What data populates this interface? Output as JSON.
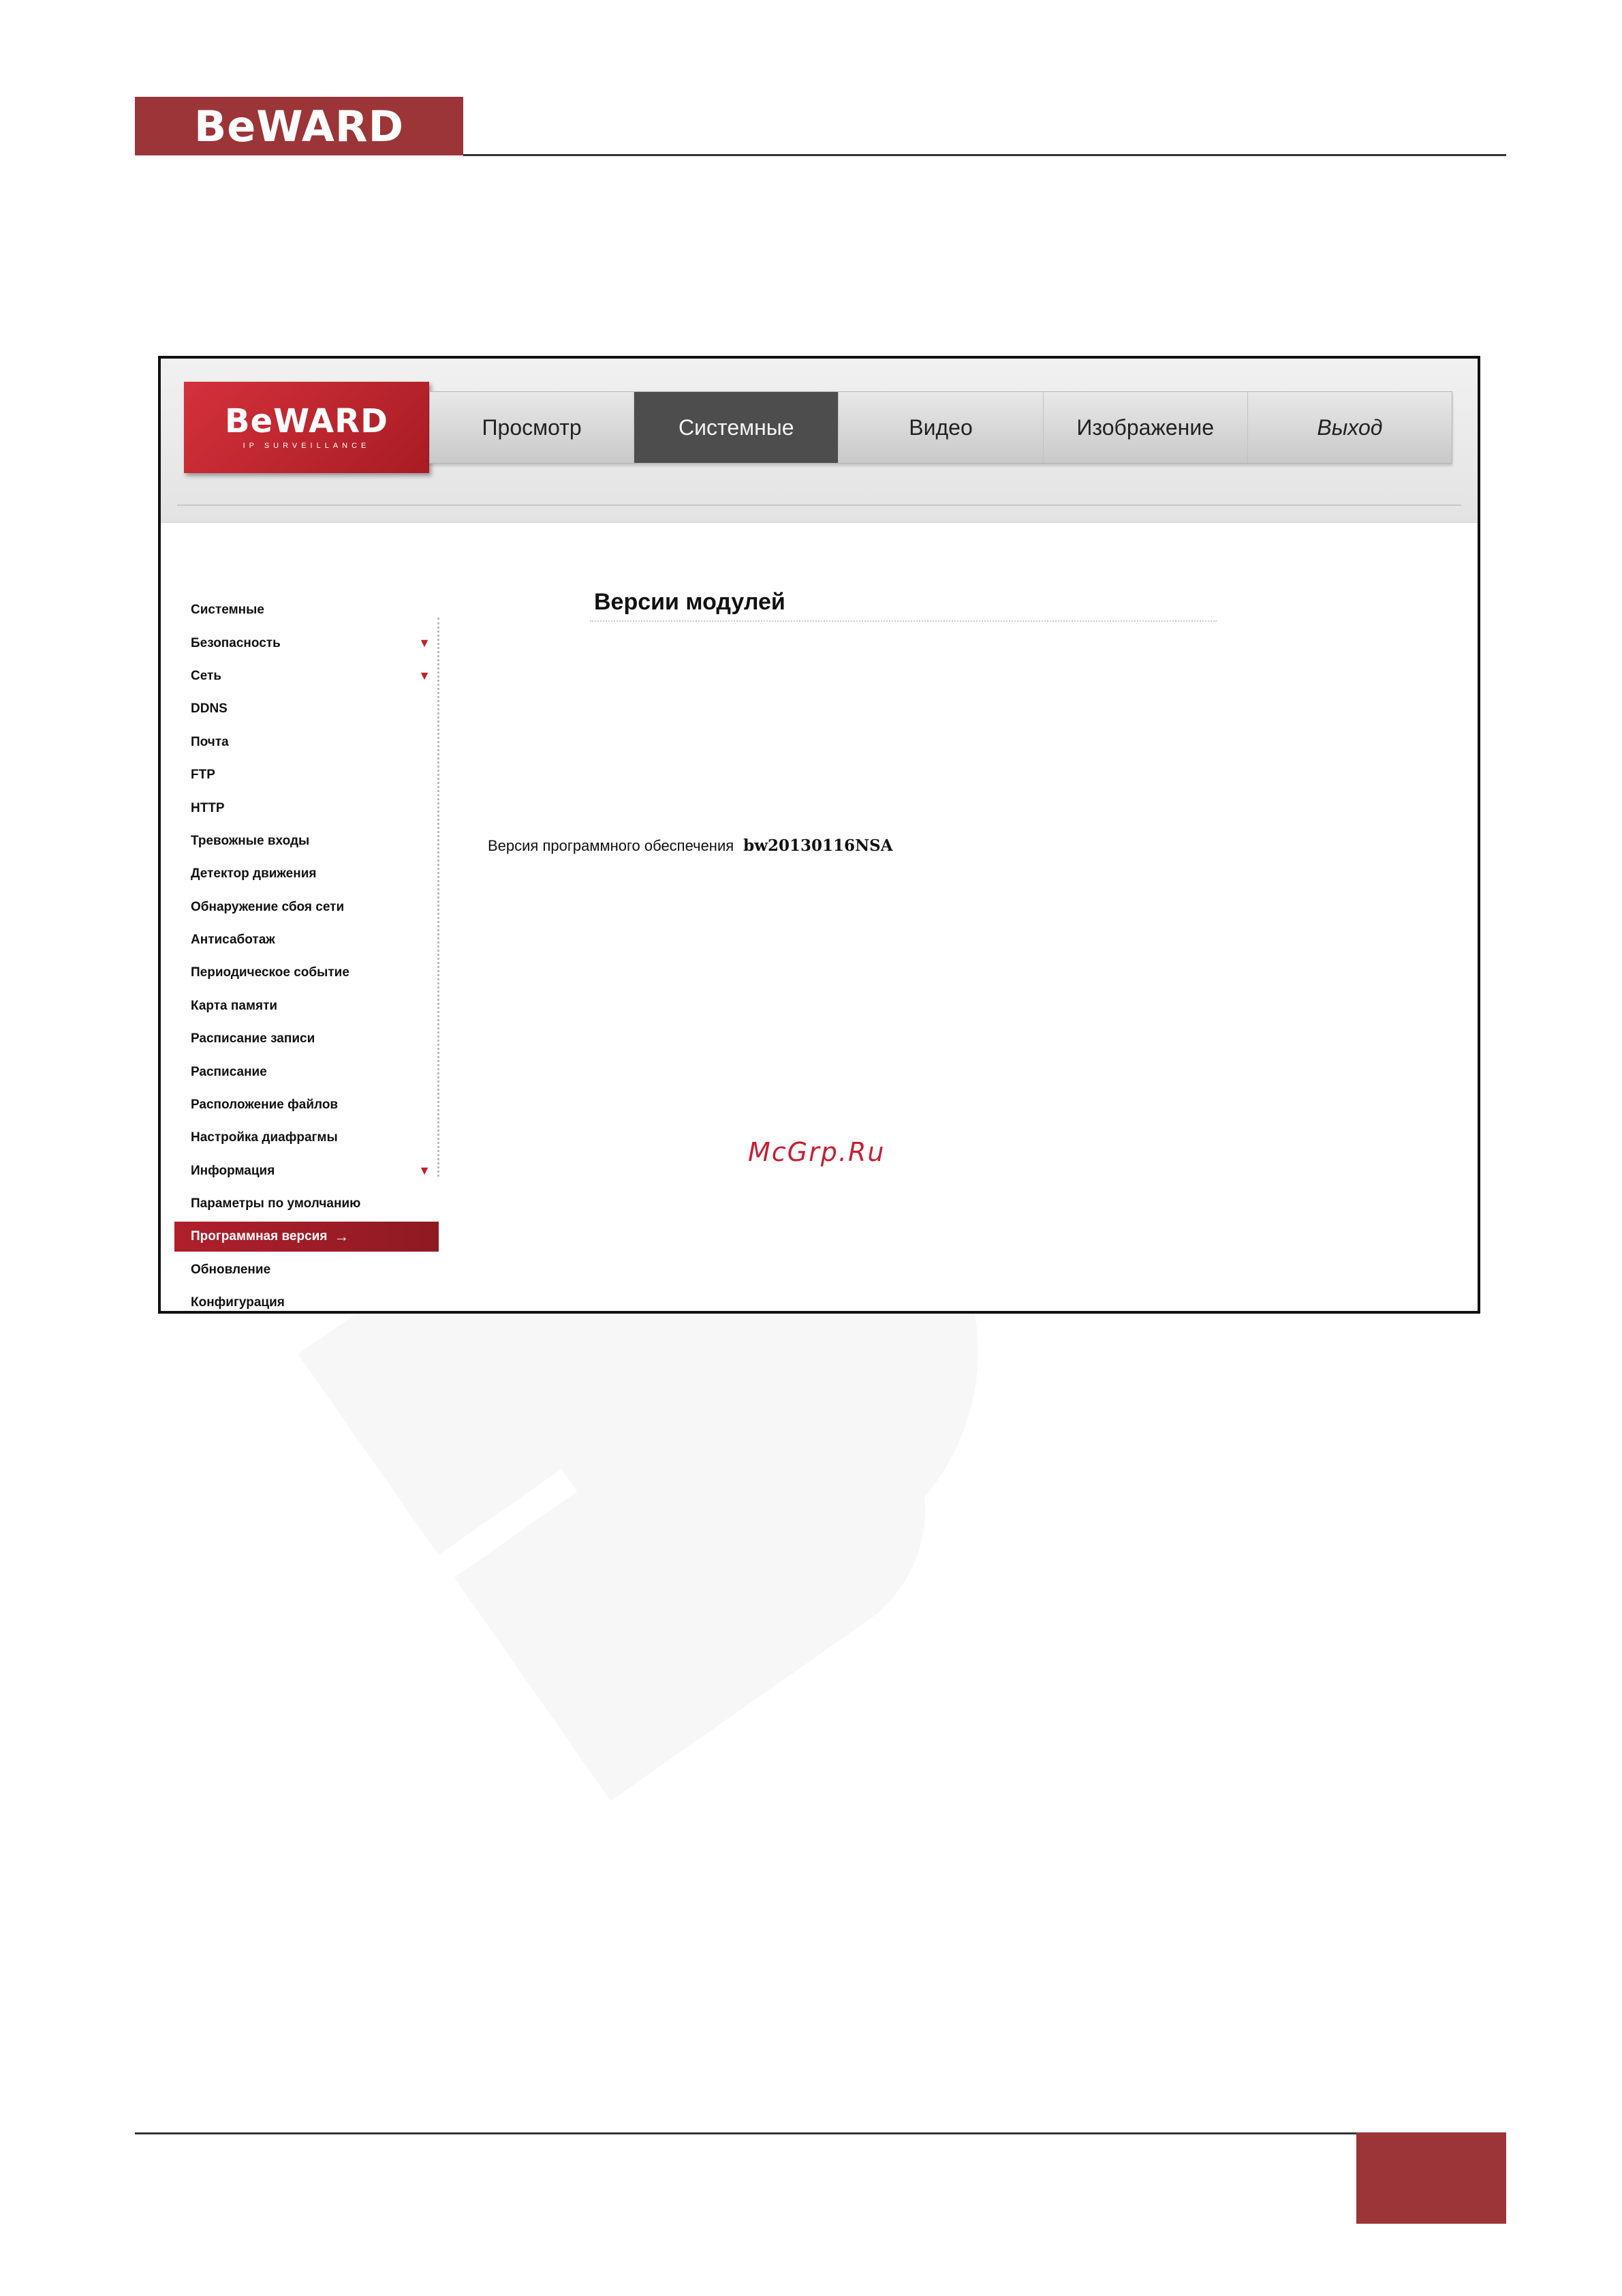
{
  "page": {
    "brand": "BeWARD",
    "accent_color": "#9c3537"
  },
  "app": {
    "logo": {
      "brand": "BeWARD",
      "tagline": "IP SURVEILLANCE"
    },
    "nav": [
      {
        "label": "Просмотр",
        "active": false
      },
      {
        "label": "Системные",
        "active": true
      },
      {
        "label": "Видео",
        "active": false
      },
      {
        "label": "Изображение",
        "active": false
      },
      {
        "label": "Выход",
        "active": false
      }
    ],
    "sidebar": {
      "items": [
        {
          "label": "Системные",
          "expand": ""
        },
        {
          "label": "Безопасность",
          "expand": "▼"
        },
        {
          "label": "Сеть",
          "expand": "▼"
        },
        {
          "label": "DDNS",
          "expand": ""
        },
        {
          "label": "Почта",
          "expand": ""
        },
        {
          "label": "FTP",
          "expand": ""
        },
        {
          "label": "HTTP",
          "expand": ""
        },
        {
          "label": "Тревожные входы",
          "expand": ""
        },
        {
          "label": "Детектор движения",
          "expand": ""
        },
        {
          "label": "Обнаружение сбоя сети",
          "expand": ""
        },
        {
          "label": "Антисаботаж",
          "expand": ""
        },
        {
          "label": "Периодическое событие",
          "expand": ""
        },
        {
          "label": "Карта памяти",
          "expand": ""
        },
        {
          "label": "Расписание записи",
          "expand": ""
        },
        {
          "label": "Расписание",
          "expand": ""
        },
        {
          "label": "Расположение файлов",
          "expand": ""
        },
        {
          "label": "Настройка диафрагмы",
          "expand": ""
        },
        {
          "label": "Информация",
          "expand": "▼"
        },
        {
          "label": "Параметры по умолчанию",
          "expand": ""
        },
        {
          "label": "Программная версия",
          "expand": "→",
          "active": true
        },
        {
          "label": "Обновление",
          "expand": ""
        },
        {
          "label": "Конфигурация",
          "expand": ""
        }
      ]
    },
    "main": {
      "title": "Версии модулей",
      "software_version_label": "Версия программного обеспечения",
      "software_version_value": "bw20130116NSA"
    },
    "site_mark": "McGrp.Ru"
  }
}
